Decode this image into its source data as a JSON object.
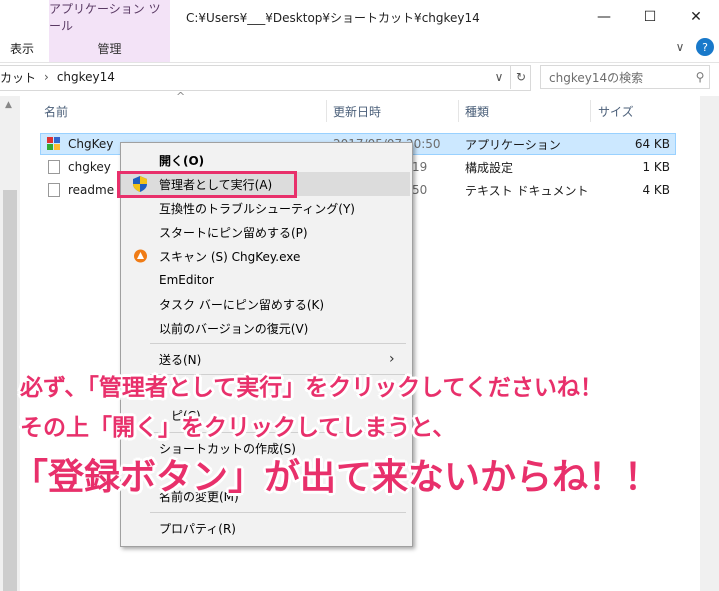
{
  "window": {
    "context_tab": "アプリケーション ツール",
    "path_title": "C:¥Users¥___¥Desktop¥ショートカット¥chgkey14",
    "minimize_glyph": "—",
    "maximize_glyph": "☐",
    "close_glyph": "✕",
    "help_glyph": "?",
    "collapse_glyph": "∨"
  },
  "ribbon": {
    "view_tab": "表示",
    "manage_tab": "管理"
  },
  "address": {
    "prefix": "カット",
    "sep": "›",
    "folder": "chgkey14",
    "dropdown_glyph": "∨",
    "refresh_glyph": "↻"
  },
  "search": {
    "placeholder": "chgkey14の検索",
    "icon": "⚲"
  },
  "columns": {
    "name": "名前",
    "modified": "更新日時",
    "type": "種類",
    "size": "サイズ",
    "sort_glyph": "^"
  },
  "files": [
    {
      "name": "ChgKey",
      "modified": "2017/05/07 20:50",
      "type": "アプリケーション",
      "size": "64 KB",
      "icon": "app-icon",
      "selected": true
    },
    {
      "name": "chgkey",
      "modified": "19",
      "type": "構成設定",
      "size": "1 KB",
      "icon": "config-file-icon",
      "selected": false
    },
    {
      "name": "readme",
      "modified": "50",
      "type": "テキスト ドキュメント",
      "size": "4 KB",
      "icon": "text-file-icon",
      "selected": false
    }
  ],
  "context_menu": {
    "open": "開く(O)",
    "run_as_admin": "管理者として実行(A)",
    "troubleshoot": "互換性のトラブルシューティング(Y)",
    "pin_start": "スタートにピン留めする(P)",
    "scan": "スキャン (S) ChgKey.exe",
    "emeditor": "EmEditor",
    "pin_taskbar": "タスク バーにピン留めする(K)",
    "restore_prev": "以前のバージョンの復元(V)",
    "send_to": "送る(N)",
    "submenu_glyph": "›",
    "partial_c": "ピ(C)",
    "create_shortcut": "ショートカットの作成(S)",
    "rename_partial": "名前の変更(M)",
    "properties": "プロパティ(R)"
  },
  "annotation": {
    "line1": "必ず、「管理者として実行」をクリックしてくださいね！",
    "line2": "その上「開く」をクリックしてしまうと、",
    "line3": "「登録ボタン」が出て来ないからね！！"
  },
  "colors": {
    "accent_pink": "#e8306b",
    "selection": "#cce8ff",
    "context_tab_bg": "#f3e3f7",
    "shield_blue": "#1f5fbf",
    "shield_yellow": "#f2c318",
    "avast_orange": "#f07c16"
  }
}
